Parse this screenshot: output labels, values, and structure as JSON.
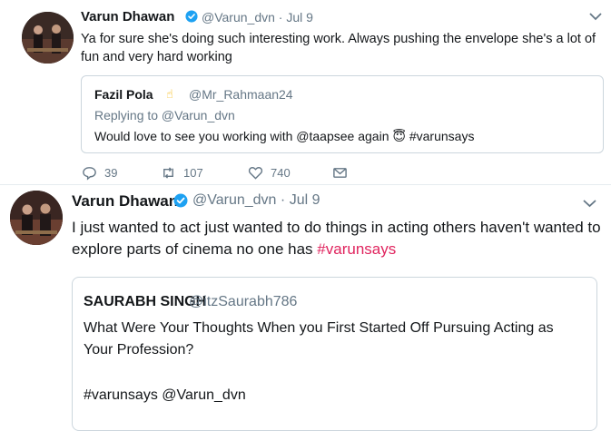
{
  "tweet1": {
    "author_name": "Varun Dhawan",
    "handle": "@Varun_dvn",
    "date": "Jul 9",
    "text": "Ya for sure she's doing such interesting work. Always pushing the envelope she's a lot of fun and very hard working",
    "quote": {
      "author_name": "Fazil Pola",
      "handle": "@Mr_Rahmaan24",
      "replying_to": "Replying to @Varun_dvn",
      "text": "Would love to see you working with @taapsee again 😇 #varunsays"
    },
    "actions": {
      "replies": "39",
      "retweets": "107",
      "likes": "740"
    }
  },
  "tweet2": {
    "author_name": "Varun Dhawan",
    "handle": "@Varun_dvn",
    "date": "Jul 9",
    "text": "I just wanted to act just wanted to do things in acting others haven't wanted to explore parts of cinema no one has",
    "hashtag": "#varunsays",
    "quote": {
      "author_name": "SAURABH SINGH",
      "handle": "@itzSaurabh786",
      "text": "What Were Your Thoughts When you First Started Off Pursuing Acting as Your Profession?",
      "tags": "#varunsays @Varun_dvn"
    }
  },
  "colors": {
    "secondary_text": "#657786",
    "verified_blue": "#1da1f2",
    "hashtag": "#e0245e",
    "border": "#ccd6dd"
  },
  "icons": [
    "reply-icon",
    "retweet-icon",
    "like-icon",
    "message-icon",
    "verified-badge-icon",
    "chevron-down-icon"
  ]
}
